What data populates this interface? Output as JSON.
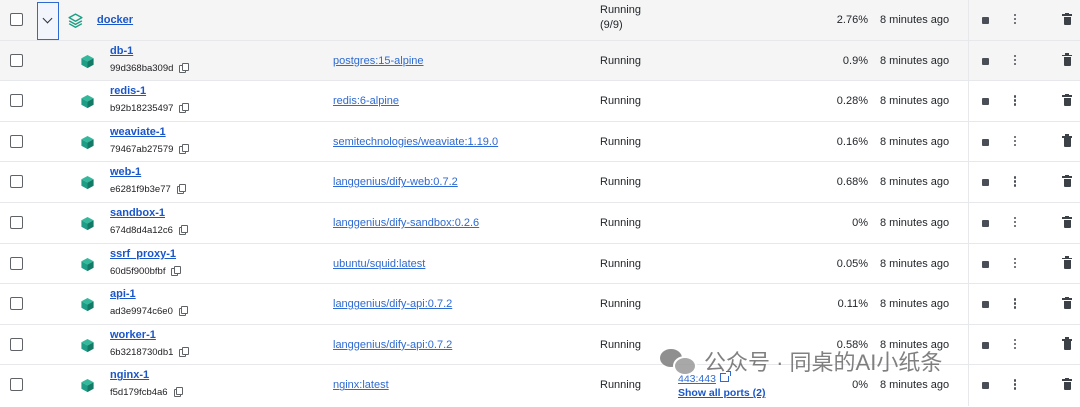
{
  "group": {
    "name": "docker",
    "status": "Running",
    "status_count": "(9/9)",
    "cpu": "2.76%",
    "last_started": "8 minutes ago"
  },
  "containers": [
    {
      "name": "db-1",
      "id": "99d368ba309d",
      "image": "postgres:15-alpine",
      "status": "Running",
      "cpu": "0.9%",
      "last_started": "8 minutes ago"
    },
    {
      "name": "redis-1",
      "id": "b92b18235497",
      "image": "redis:6-alpine",
      "status": "Running",
      "cpu": "0.28%",
      "last_started": "8 minutes ago"
    },
    {
      "name": "weaviate-1",
      "id": "79467ab27579",
      "image": "semitechnologies/weaviate:1.19.0",
      "status": "Running",
      "cpu": "0.16%",
      "last_started": "8 minutes ago"
    },
    {
      "name": "web-1",
      "id": "e6281f9b3e77",
      "image": "langgenius/dify-web:0.7.2",
      "status": "Running",
      "cpu": "0.68%",
      "last_started": "8 minutes ago"
    },
    {
      "name": "sandbox-1",
      "id": "674d8d4a12c6",
      "image": "langgenius/dify-sandbox:0.2.6",
      "status": "Running",
      "cpu": "0%",
      "last_started": "8 minutes ago"
    },
    {
      "name": "ssrf_proxy-1",
      "id": "60d5f900bfbf",
      "image": "ubuntu/squid:latest",
      "status": "Running",
      "cpu": "0.05%",
      "last_started": "8 minutes ago"
    },
    {
      "name": "api-1",
      "id": "ad3e9974c6e0",
      "image": "langgenius/dify-api:0.7.2",
      "status": "Running",
      "cpu": "0.11%",
      "last_started": "8 minutes ago"
    },
    {
      "name": "worker-1",
      "id": "6b3218730db1",
      "image": "langgenius/dify-api:0.7.2",
      "status": "Running",
      "cpu": "0.58%",
      "last_started": "8 minutes ago"
    },
    {
      "name": "nginx-1",
      "id": "f5d179fcb4a6",
      "image": "nginx:latest",
      "status": "Running",
      "cpu": "0%",
      "last_started": "8 minutes ago",
      "port": "443:443",
      "all_ports_label": "Show all ports (2)"
    }
  ],
  "watermark": "公众号 · 同桌的AI小纸条",
  "colors": {
    "accent": "#2e6ad1",
    "container_icon": "#1e9e86",
    "row_highlight": "#f5f5f5"
  },
  "icons": {
    "group": "stack-icon",
    "container": "container-cube-icon",
    "copy": "copy-icon",
    "stop": "stop-icon",
    "more": "kebab-menu-icon",
    "delete": "trash-icon",
    "external": "external-link-icon"
  }
}
